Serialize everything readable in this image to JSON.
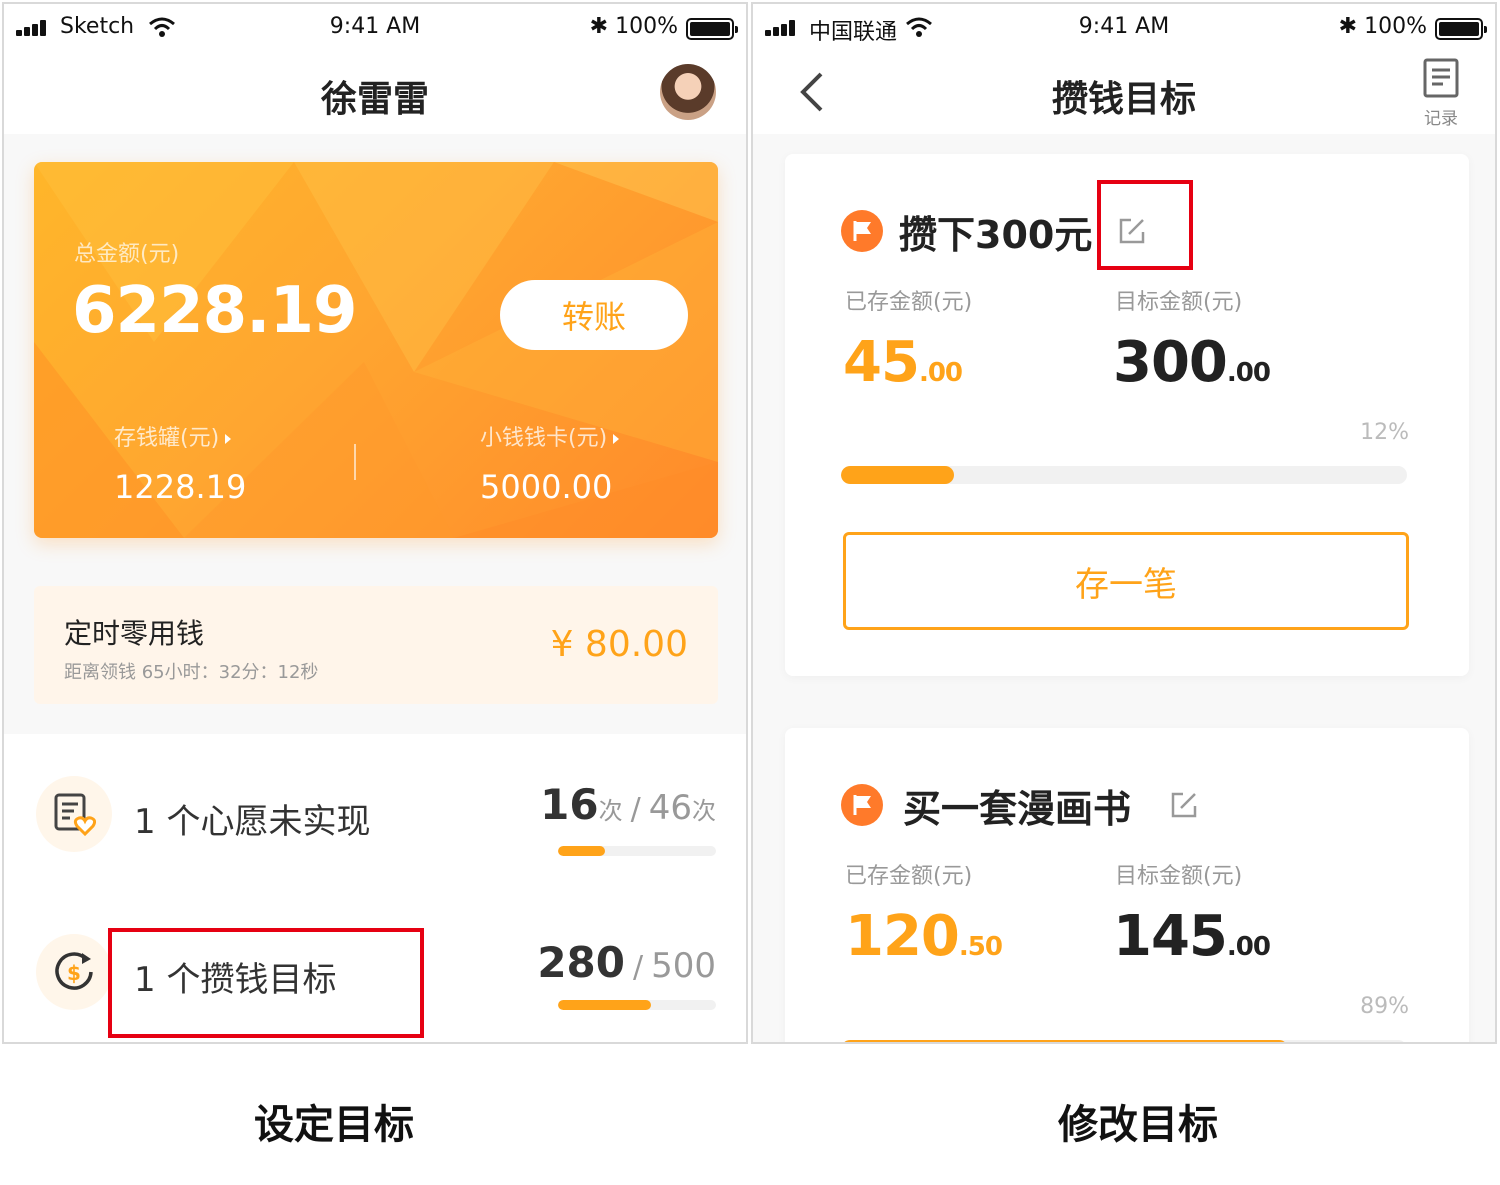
{
  "left_screen": {
    "status_bar": {
      "carrier": "Sketch",
      "time": "9:41 AM",
      "battery": "100%"
    },
    "nav_title": "徐雷雷",
    "summary_card": {
      "total_label": "总金额(元)",
      "total_amount": "6228.19",
      "transfer_label": "转账",
      "piggy_label": "存钱罐(元)",
      "piggy_value": "1228.19",
      "card_label": "小钱钱卡(元)",
      "card_value": "5000.00"
    },
    "allowance": {
      "title": "定时零用钱",
      "countdown": "距离领钱 65小时：32分：12秒",
      "amount": "¥ 80.00"
    },
    "wish_row": {
      "label": "1 个心愿未实现",
      "done": "16",
      "done_unit": "次",
      "total": "46",
      "total_unit": "次",
      "progress": 0.3
    },
    "goal_row": {
      "label": "1 个攒钱目标",
      "current": "280",
      "total": "500",
      "progress": 0.59
    },
    "caption": "设定目标"
  },
  "right_screen": {
    "status_bar": {
      "carrier": "中国联通",
      "time": "9:41 AM",
      "battery": "100%"
    },
    "nav_title": "攒钱目标",
    "record_label": "记录",
    "goals": [
      {
        "title": "攒下300元",
        "saved_label": "已存金额(元)",
        "saved_int": "45",
        "saved_dec": ".00",
        "target_label": "目标金额(元)",
        "target_int": "300",
        "target_dec": ".00",
        "percent": "12%",
        "progress": 0.2,
        "button_label": "存一笔"
      },
      {
        "title": "买一套漫画书",
        "saved_label": "已存金额(元)",
        "saved_int": "120",
        "saved_dec": ".50",
        "target_label": "目标金额(元)",
        "target_int": "145",
        "target_dec": ".00",
        "percent": "89%",
        "progress": 0.79
      }
    ],
    "caption": "修改目标"
  },
  "colors": {
    "accent": "#ffa319",
    "highlight_box": "#e60012",
    "flag": "#ff7a2a"
  }
}
